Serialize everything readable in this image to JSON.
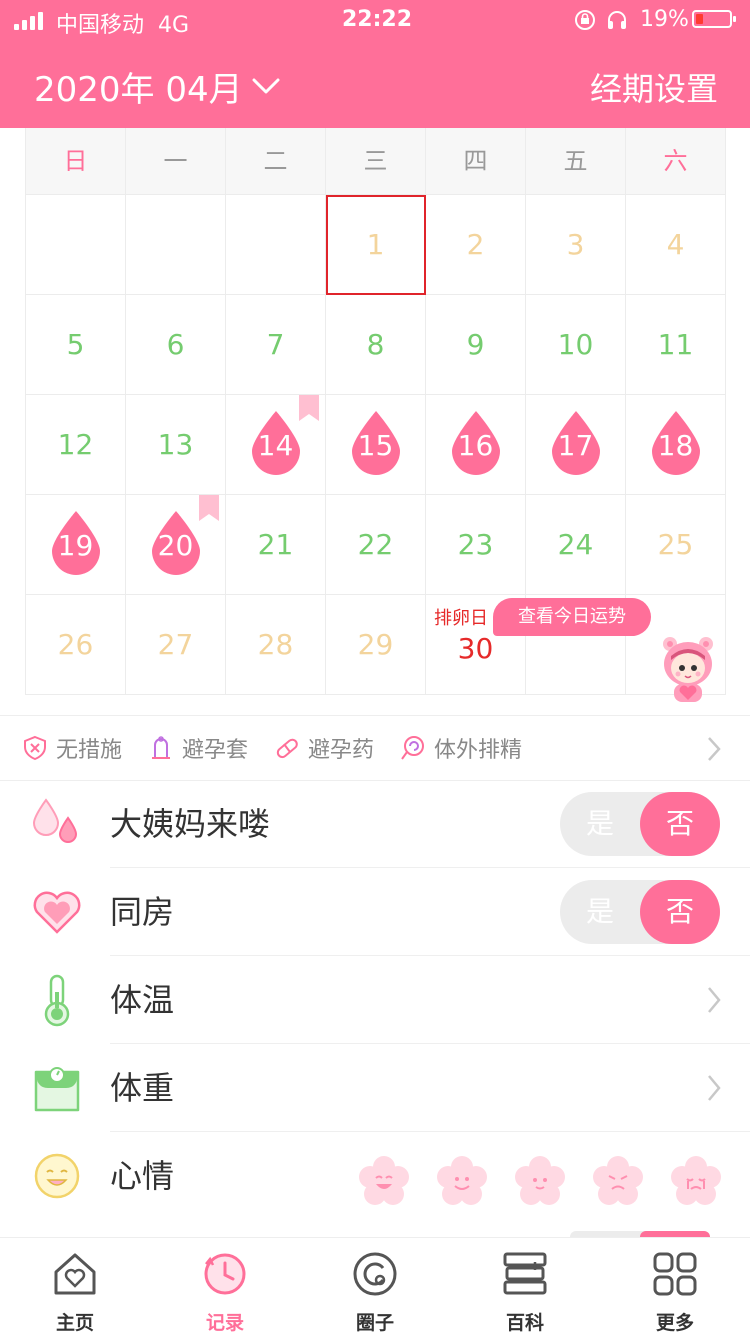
{
  "status_bar": {
    "carrier": "中国移动",
    "network": "4G",
    "time": "22:22",
    "battery": "19%"
  },
  "header": {
    "month_label": "2020年 04月",
    "settings_label": "经期设置"
  },
  "calendar": {
    "weekdays": [
      "日",
      "一",
      "二",
      "三",
      "四",
      "五",
      "六"
    ],
    "weeks": [
      [
        "",
        "",
        "",
        "1",
        "2",
        "3",
        "4"
      ],
      [
        "5",
        "6",
        "7",
        "8",
        "9",
        "10",
        "11"
      ],
      [
        "12",
        "13",
        "14",
        "15",
        "16",
        "17",
        "18"
      ],
      [
        "19",
        "20",
        "21",
        "22",
        "23",
        "24",
        "25"
      ],
      [
        "26",
        "27",
        "28",
        "29",
        "30",
        "",
        ""
      ]
    ],
    "period_days": [
      "14",
      "15",
      "16",
      "17",
      "18",
      "19",
      "20"
    ],
    "bookmarked_days": [
      "14",
      "20"
    ],
    "highlighted_day": "1",
    "ovulation_label": "排卵日",
    "ovulation_day": "30",
    "fortune_button": "查看今日运势"
  },
  "contraception": {
    "options": [
      {
        "label": "无措施",
        "icon": "shield-x-icon"
      },
      {
        "label": "避孕套",
        "icon": "condom-icon"
      },
      {
        "label": "避孕药",
        "icon": "pill-icon"
      },
      {
        "label": "体外排精",
        "icon": "spiral-icon"
      }
    ]
  },
  "records": {
    "period": {
      "label": "大姨妈来喽",
      "yes": "是",
      "no": "否",
      "value": "否"
    },
    "intimacy": {
      "label": "同房",
      "yes": "是",
      "no": "否",
      "value": "否"
    },
    "temperature": {
      "label": "体温"
    },
    "weight": {
      "label": "体重"
    },
    "mood": {
      "label": "心情",
      "faces": [
        "laughing",
        "smiling",
        "content",
        "sad",
        "crying"
      ]
    }
  },
  "tabbar": {
    "tabs": [
      {
        "label": "主页",
        "icon": "home-icon"
      },
      {
        "label": "记录",
        "icon": "clock-icon"
      },
      {
        "label": "圈子",
        "icon": "circle-icon"
      },
      {
        "label": "百科",
        "icon": "books-icon"
      },
      {
        "label": "更多",
        "icon": "grid-icon"
      }
    ],
    "active": "记录"
  },
  "colors": {
    "brand": "#ff6f99",
    "future_day": "#f3d49c",
    "normal_day": "#75cc6f",
    "ovulation": "#e62a2a"
  }
}
